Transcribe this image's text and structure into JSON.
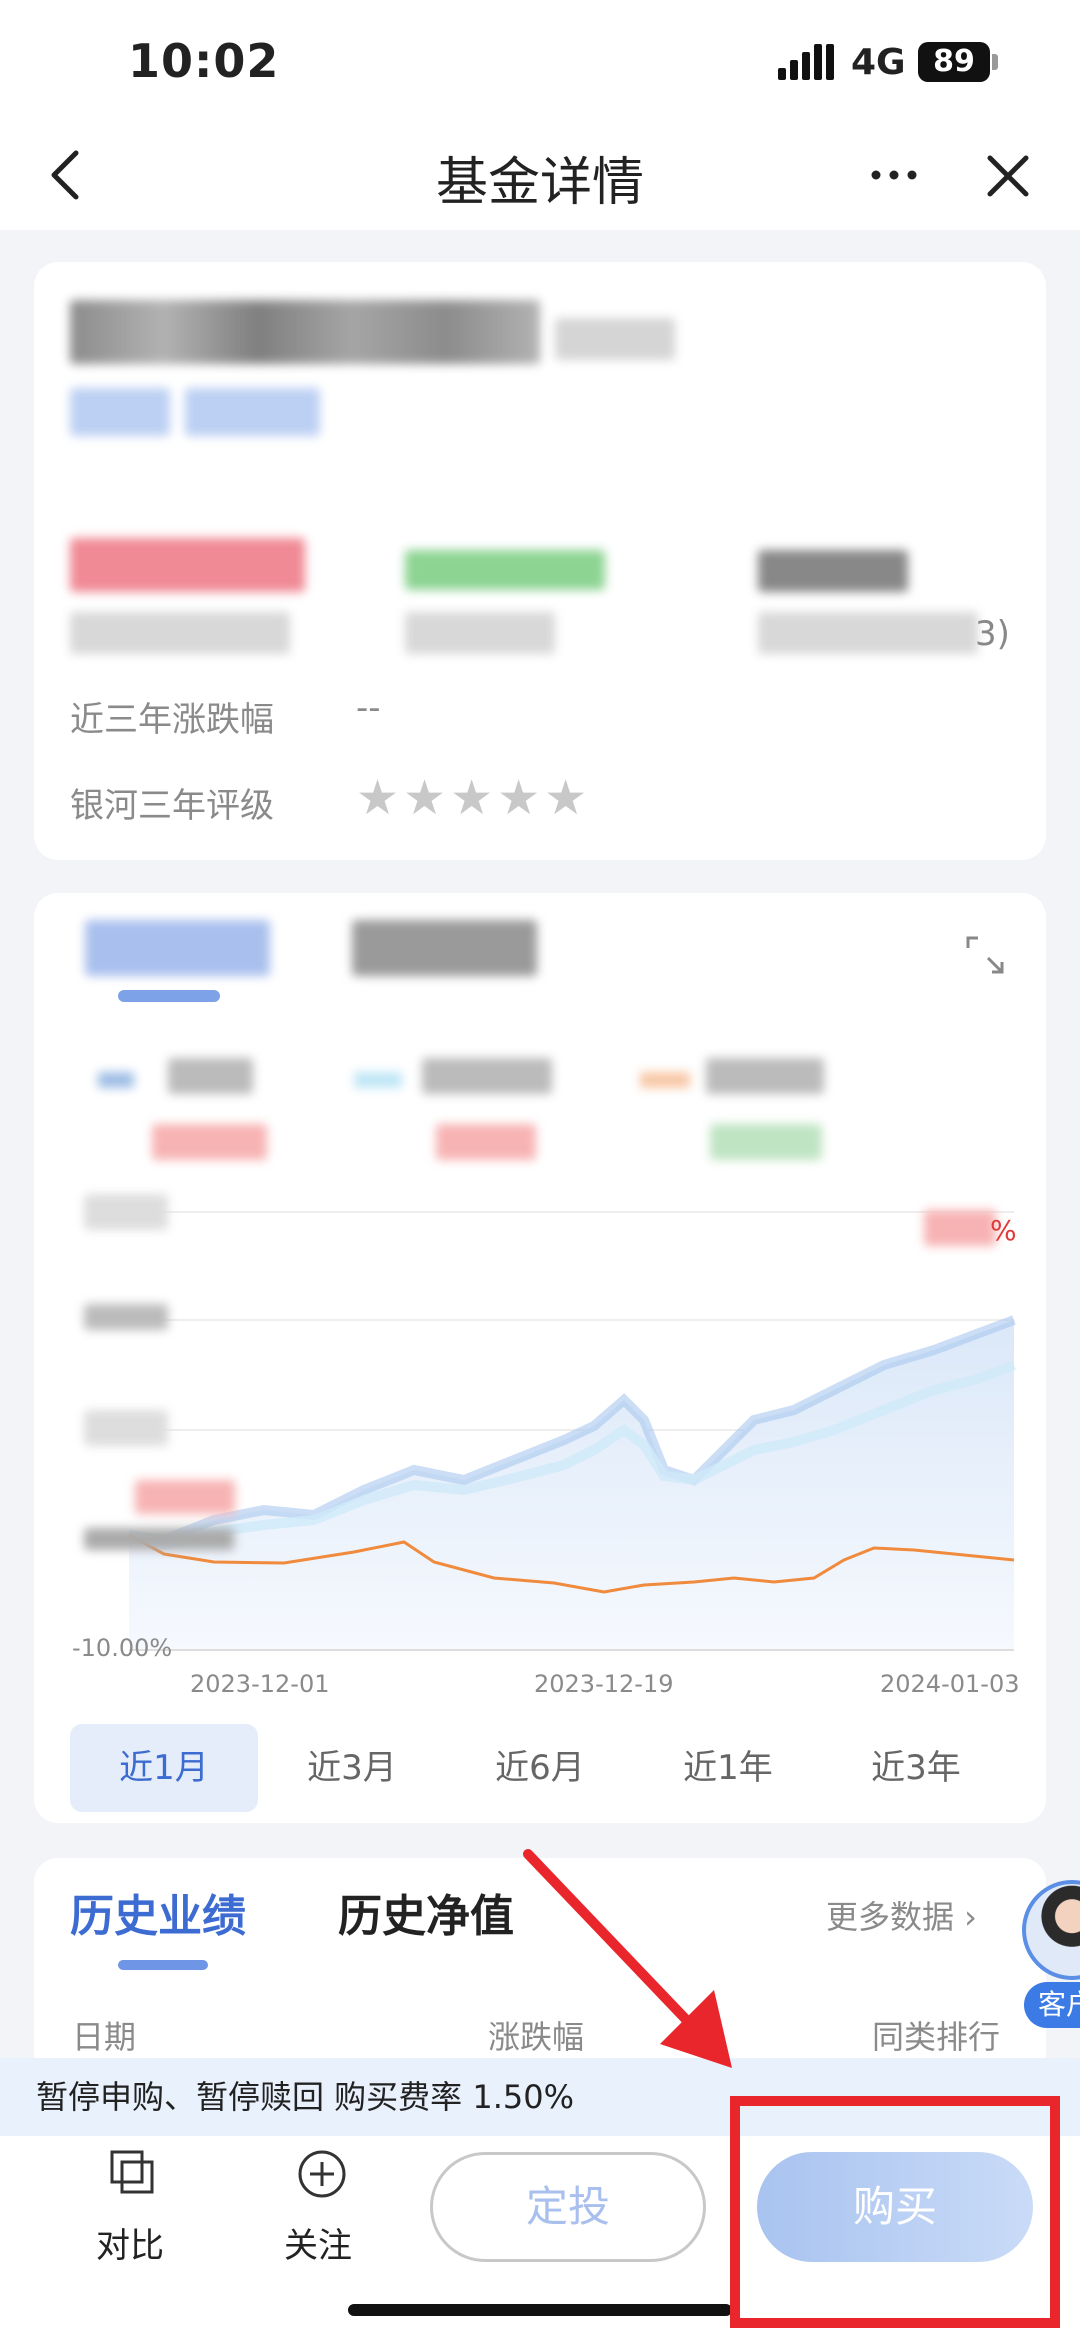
{
  "status_bar": {
    "time": "10:02",
    "network": "4G",
    "battery": "89"
  },
  "nav": {
    "title": "基金详情"
  },
  "overview": {
    "stat3_suffix": "3)",
    "near_three_year_change_label": "近三年涨跌幅",
    "near_three_year_change_value": "--",
    "rating_label": "银河三年评级",
    "rating_stars": "★★★★★"
  },
  "chart_data": {
    "type": "line",
    "x": [
      "2023-12-01",
      "2023-12-19",
      "2024-01-03"
    ],
    "y_axis_min_label": "-10.00%",
    "label_tail": "%"
  },
  "period_tabs": [
    "近1月",
    "近3月",
    "近6月",
    "近1年",
    "近3年"
  ],
  "active_period": 0,
  "history": {
    "tab_performance": "历史业绩",
    "tab_nav": "历史净值",
    "more_data": "更多数据 ›",
    "columns": [
      "日期",
      "涨跌幅",
      "同类排行"
    ]
  },
  "customer_service": {
    "label": "客户"
  },
  "notice": "暂停申购、暂停赎回 购买费率 1.50%",
  "bottom_bar": {
    "compare": "对比",
    "follow": "关注",
    "sip": "定投",
    "buy": "购买"
  },
  "colors": {
    "accent": "#3c6bd1",
    "annotation_red": "#e8262b",
    "up_red": "#e03a3a",
    "down_green": "#2fb15a"
  }
}
